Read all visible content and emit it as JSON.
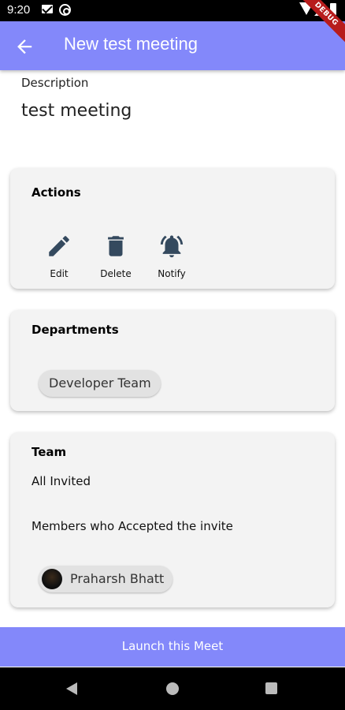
{
  "status_bar": {
    "time": "9:20",
    "icons": [
      "mail-icon",
      "at-sign-icon",
      "wifi-icon",
      "signal-icon",
      "battery-icon"
    ]
  },
  "debug_banner": "DEBUG",
  "app_bar": {
    "back_icon": "arrow-left-icon",
    "title": "New test meeting",
    "color": "#8388fa"
  },
  "description": {
    "label": "Description",
    "value": "test meeting"
  },
  "actions_card": {
    "title": "Actions",
    "items": [
      {
        "icon": "pencil-icon",
        "label": "Edit"
      },
      {
        "icon": "trash-icon",
        "label": "Delete"
      },
      {
        "icon": "bell-ringing-icon",
        "label": "Notify"
      }
    ]
  },
  "departments_card": {
    "title": "Departments",
    "chips": [
      "Developer Team"
    ]
  },
  "team_card": {
    "title": "Team",
    "all_invited": "All Invited",
    "accepted_heading": "Members who Accepted the invite",
    "members": [
      {
        "name": "Praharsh Bhatt",
        "avatar": "avatar-photo"
      }
    ]
  },
  "launch_button": {
    "label": "Launch this Meet",
    "color": "#8388fa"
  },
  "nav_bar": {
    "icons": [
      "nav-back-icon",
      "nav-home-icon",
      "nav-recents-icon"
    ]
  }
}
